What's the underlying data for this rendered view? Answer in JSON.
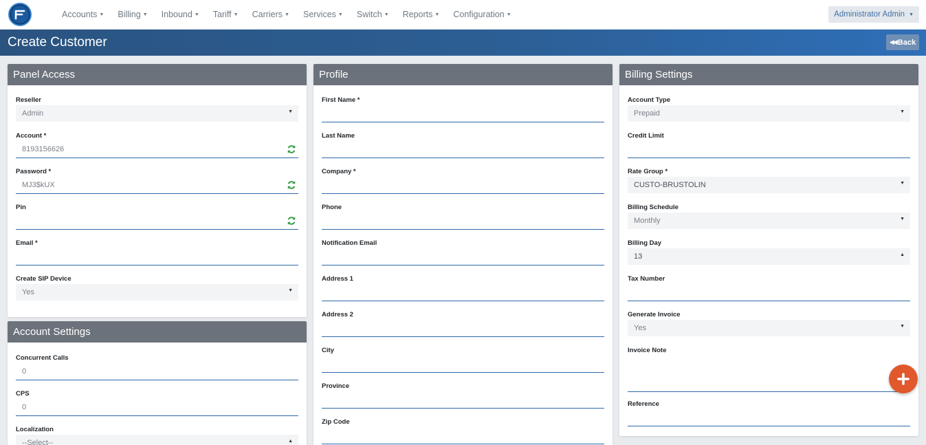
{
  "nav": {
    "items": [
      "Accounts",
      "Billing",
      "Inbound",
      "Tariff",
      "Carriers",
      "Services",
      "Switch",
      "Reports",
      "Configuration"
    ],
    "user": "Administrator Admin"
  },
  "header": {
    "title": "Create Customer",
    "back_label": "Back"
  },
  "panel_access": {
    "title": "Panel Access",
    "reseller": {
      "label": "Reseller",
      "value": "Admin"
    },
    "account": {
      "label": "Account *",
      "value": "8193156626"
    },
    "password": {
      "label": "Password *",
      "value": "MJ3$kUX"
    },
    "pin": {
      "label": "Pin",
      "value": ""
    },
    "email": {
      "label": "Email *",
      "value": ""
    },
    "sip": {
      "label": "Create SIP Device",
      "value": "Yes"
    }
  },
  "account_settings": {
    "title": "Account Settings",
    "concurrent": {
      "label": "Concurrent Calls",
      "value": "0"
    },
    "cps": {
      "label": "CPS",
      "value": "0"
    },
    "localization": {
      "label": "Localization",
      "value": "--Select--"
    }
  },
  "profile": {
    "title": "Profile",
    "first_name": "First Name *",
    "last_name": "Last Name",
    "company": "Company *",
    "phone": "Phone",
    "notification_email": "Notification Email",
    "address1": "Address 1",
    "address2": "Address 2",
    "city": "City",
    "province": "Province",
    "zip": "Zip Code"
  },
  "billing": {
    "title": "Billing Settings",
    "account_type": {
      "label": "Account Type",
      "value": "Prepaid"
    },
    "credit_limit": {
      "label": "Credit Limit",
      "value": ""
    },
    "rate_group": {
      "label": "Rate Group *",
      "value": "CUSTO-BRUSTOLIN"
    },
    "schedule": {
      "label": "Billing Schedule",
      "value": "Monthly"
    },
    "billing_day": {
      "label": "Billing Day",
      "value": "13"
    },
    "tax_number": {
      "label": "Tax Number",
      "value": ""
    },
    "generate_invoice": {
      "label": "Generate Invoice",
      "value": "Yes"
    },
    "invoice_note": {
      "label": "Invoice Note",
      "value": ""
    },
    "reference": {
      "label": "Reference",
      "value": ""
    }
  },
  "colors": {
    "nav_bg": "#ffffff",
    "header_bg": "#2c5f95",
    "panel_head": "#6c727b",
    "input_underline": "#2c69a8",
    "fab": "#e0582c",
    "refresh": "#2e9b3e"
  },
  "icons": {
    "logo": "app-logo",
    "refresh": "refresh-icon",
    "back": "fast-backward-icon",
    "fab": "plus-icon"
  }
}
